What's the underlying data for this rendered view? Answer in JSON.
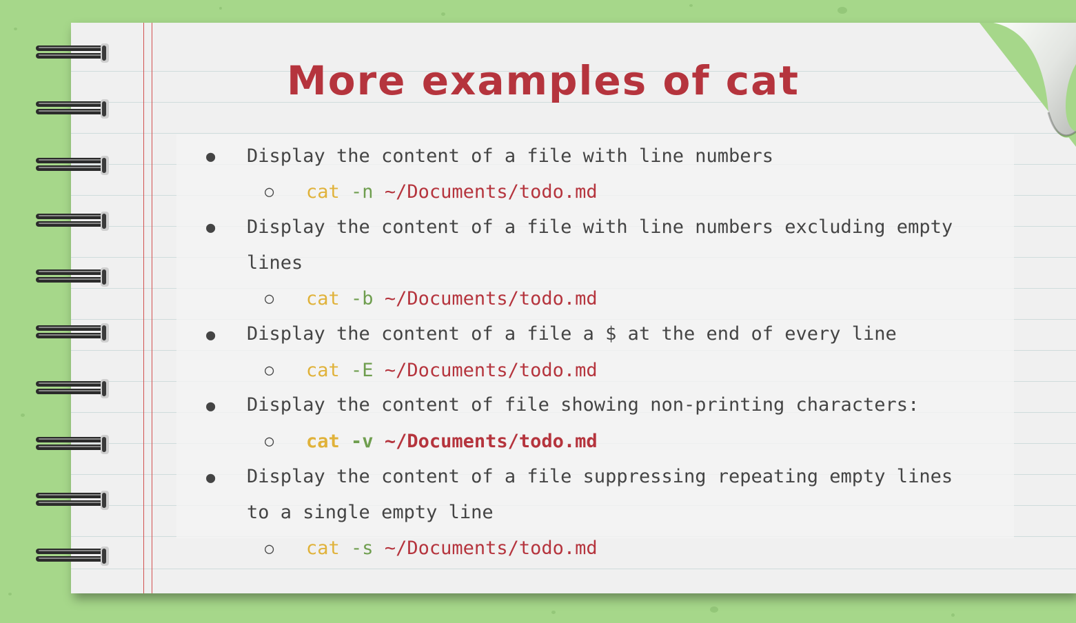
{
  "title": "More examples of cat",
  "items": [
    {
      "text_line1": "Display the content of a file with line numbers",
      "example": {
        "cmd": "cat",
        "flag": "-n",
        "path": "~/Documents/todo.md"
      }
    },
    {
      "text_line1": "Display the content of a file with line numbers excluding empty",
      "text_line2": "lines",
      "example": {
        "cmd": "cat",
        "flag": "-b",
        "path": "~/Documents/todo.md"
      }
    },
    {
      "text_line1": "Display the content of a file a $ at the end of every line",
      "example": {
        "cmd": "cat",
        "flag": "-E",
        "path": "~/Documents/todo.md"
      }
    },
    {
      "text_line1": "Display the content of file showing non-printing characters:",
      "example": {
        "cmd": "cat",
        "flag": "-v",
        "path": "~/Documents/todo.md"
      }
    },
    {
      "text_line1": "Display the content of a file suppressing repeating empty lines",
      "text_line2": "to a single empty line",
      "example": {
        "cmd": "cat",
        "flag": "-s",
        "path": "~/Documents/todo.md"
      }
    }
  ],
  "colors": {
    "background": "#a6d78a",
    "paper": "#f0f0f0",
    "title": "#b5343d",
    "command": "#e0b23a",
    "flag": "#6f9e4f",
    "path": "#b5343d",
    "text": "#444444"
  },
  "icons": {
    "binding": "spiral-ring-icon",
    "bullet": "filled-circle-bullet-icon",
    "sub_bullet": "hollow-circle-bullet-icon"
  }
}
